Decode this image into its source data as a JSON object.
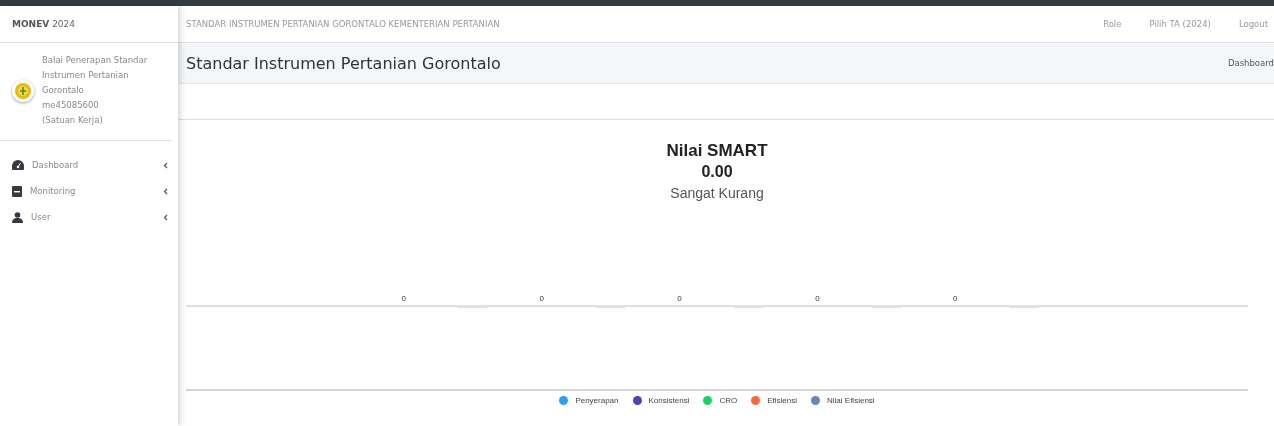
{
  "brand": {
    "name": "MONEV",
    "year": "2024"
  },
  "topbar": {
    "title": "STANDAR INSTRUMEN PERTANIAN GORONTALO KEMENTERIAN PERTANIAN",
    "links": [
      "Role",
      "Pilih TA (2024)",
      "Logout"
    ]
  },
  "user": {
    "lines": [
      "Balai Penerapan Standar",
      "Instrumen Pertanian",
      "Gorontalo",
      "me45085600",
      "(Satuan Kerja)"
    ]
  },
  "sidebar": {
    "items": [
      {
        "label": "Dashboard",
        "expanded": false
      },
      {
        "label": "Monitoring",
        "expanded": false
      },
      {
        "label": "User",
        "expanded": false
      }
    ]
  },
  "page": {
    "title": "Standar Instrumen Pertanian Gorontalo",
    "breadcrumb": "Dashboard"
  },
  "summary": {
    "title": "Nilai SMART",
    "value": "0.00",
    "rating": "Sangat Kurang"
  },
  "chart": {
    "bar_labels": [
      "0",
      "0",
      "0",
      "0",
      "0"
    ],
    "legend": [
      {
        "name": "Penyerapan",
        "color": "#2e9ef5"
      },
      {
        "name": "Konsistensi",
        "color": "#4e44b8"
      },
      {
        "name": "CRO",
        "color": "#1ed06a"
      },
      {
        "name": "Efisiensi",
        "color": "#f7683a"
      },
      {
        "name": "Nilai Efisiensi",
        "color": "#6a86b8"
      }
    ]
  }
}
